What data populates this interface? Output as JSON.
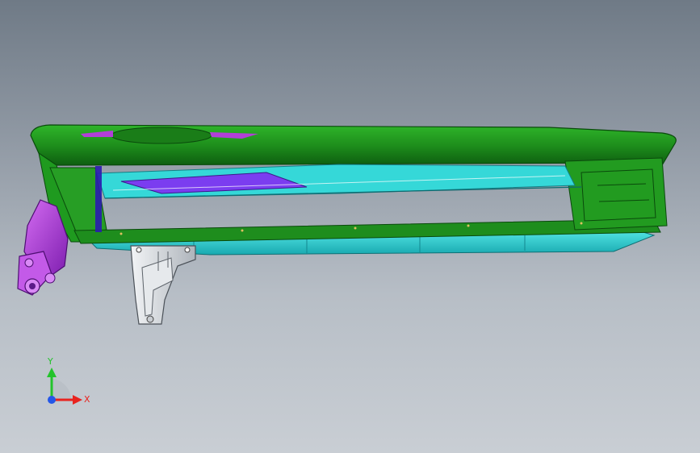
{
  "colors": {
    "background_top": "#6f7a86",
    "background_bottom": "#c9ced4",
    "beam_green": "#1f9a1f",
    "beam_green_dark": "#0f5f12",
    "cyan_part": "#2fd6d6",
    "magenta_part": "#b23fd8",
    "purple_inner": "#7b3df0",
    "bracket_gray": "#d9dde2",
    "axis_x": "#e8231f",
    "axis_y": "#23c32b",
    "axis_z": "#2457e8"
  },
  "model": {
    "parts": [
      "green-beam",
      "cyan-lower-panel",
      "magenta-left-bracket",
      "gray-mount-bracket",
      "right-end-cap"
    ]
  },
  "triad": {
    "x_label": "X",
    "y_label": "Y",
    "icons": [
      "x-axis-arrow-icon",
      "y-axis-arrow-icon",
      "z-axis-dot-icon"
    ]
  }
}
